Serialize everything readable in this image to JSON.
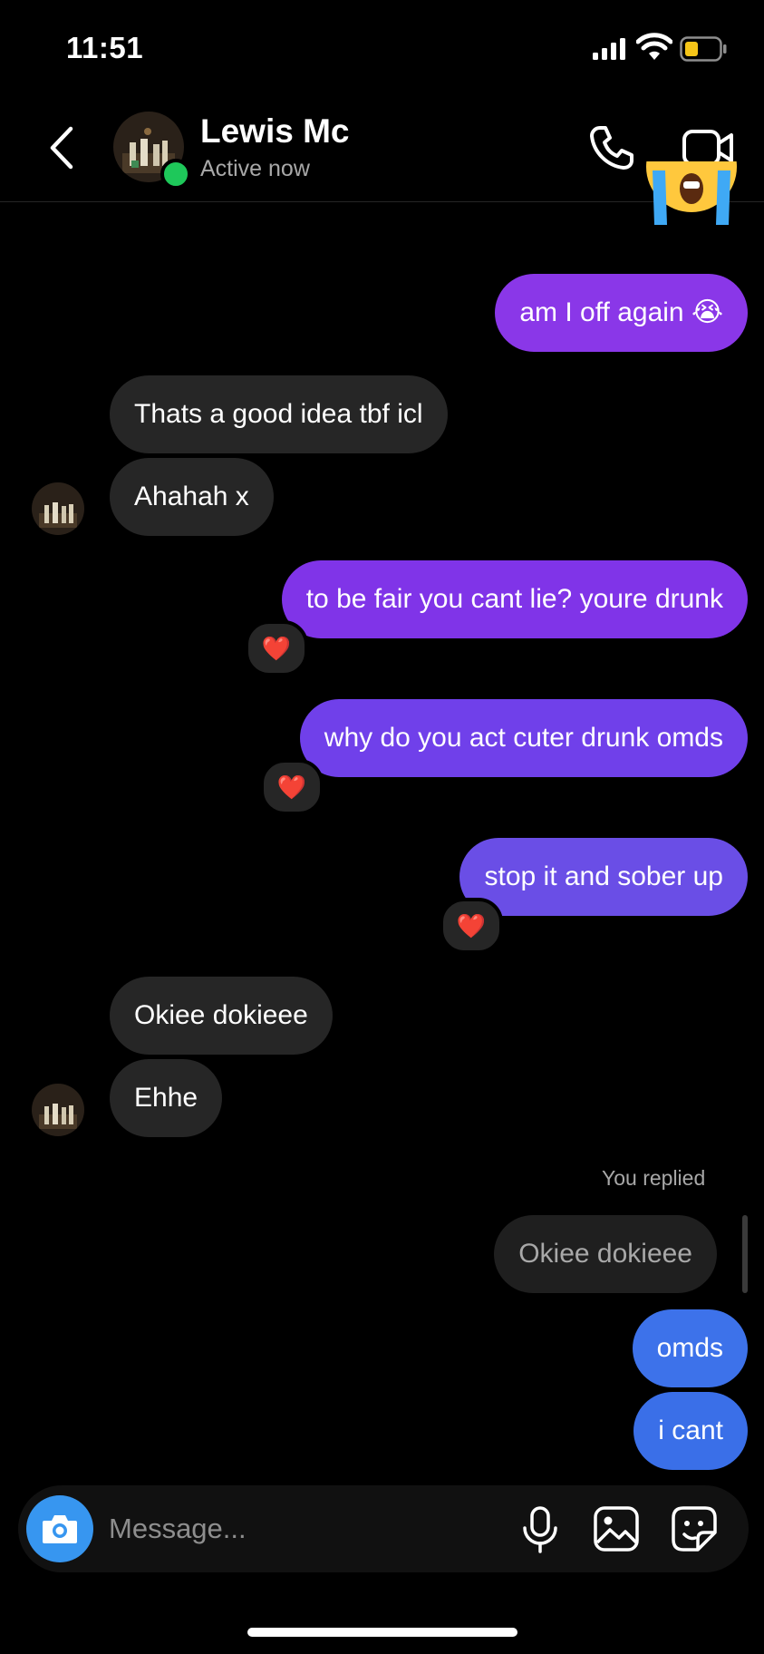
{
  "status_bar": {
    "time": "11:51"
  },
  "header": {
    "name": "Lewis Mc",
    "status": "Active now"
  },
  "messages": [
    {
      "text": "am I off again 😭",
      "side": "out"
    },
    {
      "text": "Thats a good idea tbf icl",
      "side": "in"
    },
    {
      "text": "Ahahah x",
      "side": "in"
    },
    {
      "text": "to be fair you cant lie? youre drunk",
      "side": "out",
      "reaction": "❤️"
    },
    {
      "text": "why do you act cuter drunk omds",
      "side": "out",
      "reaction": "❤️"
    },
    {
      "text": "stop it and sober up",
      "side": "out",
      "reaction": "❤️"
    },
    {
      "text": "Okiee dokieee",
      "side": "in"
    },
    {
      "text": "Ehhe",
      "side": "in"
    },
    {
      "text": "omds",
      "side": "out"
    },
    {
      "text": "i cant",
      "side": "out"
    }
  ],
  "reply": {
    "label": "You replied",
    "quoted": "Okiee dokieee"
  },
  "composer": {
    "placeholder": "Message..."
  },
  "colors": {
    "gradient_purple": "#8a37e8",
    "gradient_violet": "#6a4ee6",
    "gradient_blue": "#3d72ea",
    "incoming_bubble": "#262626",
    "online": "#1ec85a",
    "camera_button": "#3796f0",
    "battery_low": "#f5c518"
  },
  "icons": [
    "back-chevron-icon",
    "phone-icon",
    "video-camera-icon",
    "camera-icon",
    "microphone-icon",
    "gallery-icon",
    "sticker-icon"
  ]
}
